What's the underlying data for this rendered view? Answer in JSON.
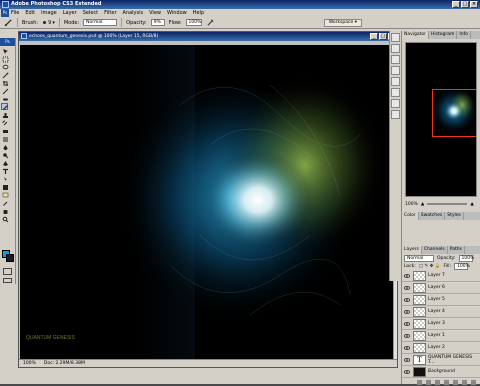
{
  "app": {
    "title": "Adobe Photoshop CS3 Extended"
  },
  "menus": [
    "File",
    "Edit",
    "Image",
    "Layer",
    "Select",
    "Filter",
    "Analysis",
    "View",
    "Window",
    "Help"
  ],
  "options": {
    "brush_label": "Brush:",
    "brush_size": "9",
    "mode_label": "Mode:",
    "mode_value": "Normal",
    "opacity_label": "Opacity:",
    "opacity_value": "9%",
    "flow_label": "Flow:",
    "flow_value": "100%",
    "workspace_label": "Workspace"
  },
  "document": {
    "title": "echoes_quantum_genesis.psd @ 100% (Layer 15, RGB/8)",
    "watermark": "QUANTUM GENESIS",
    "status_zoom": "100%",
    "status_doc": "Doc: 2.29M/8.38M"
  },
  "navigator": {
    "tabs": [
      "Navigator",
      "Histogram",
      "Info"
    ],
    "zoom": "100%"
  },
  "color_panel": {
    "tabs": [
      "Color",
      "Swatches",
      "Styles"
    ]
  },
  "layers_panel": {
    "tabs": [
      "Layers",
      "Channels",
      "Paths"
    ],
    "blend_mode": "Normal",
    "opacity_label": "Opacity:",
    "opacity_value": "100%",
    "lock_label": "Lock:",
    "fill_label": "Fill:",
    "fill_value": "100%",
    "layers": [
      {
        "name": "Layer 7",
        "thumb": "checker"
      },
      {
        "name": "Layer 6",
        "thumb": "checker"
      },
      {
        "name": "Layer 5",
        "thumb": "checker"
      },
      {
        "name": "Layer 4",
        "thumb": "checker"
      },
      {
        "name": "Layer 3",
        "thumb": "checker"
      },
      {
        "name": "Layer 1",
        "thumb": "checker"
      },
      {
        "name": "Layer 2",
        "thumb": "checker"
      },
      {
        "name": "QUANTUM GENESIS T...",
        "thumb": "text",
        "glyph": "T"
      },
      {
        "name": "Background",
        "thumb": "dark"
      }
    ]
  },
  "colors": {
    "foreground": "#00a2e8",
    "background": "#1b1b1b",
    "accent": "#1c4f9c"
  }
}
